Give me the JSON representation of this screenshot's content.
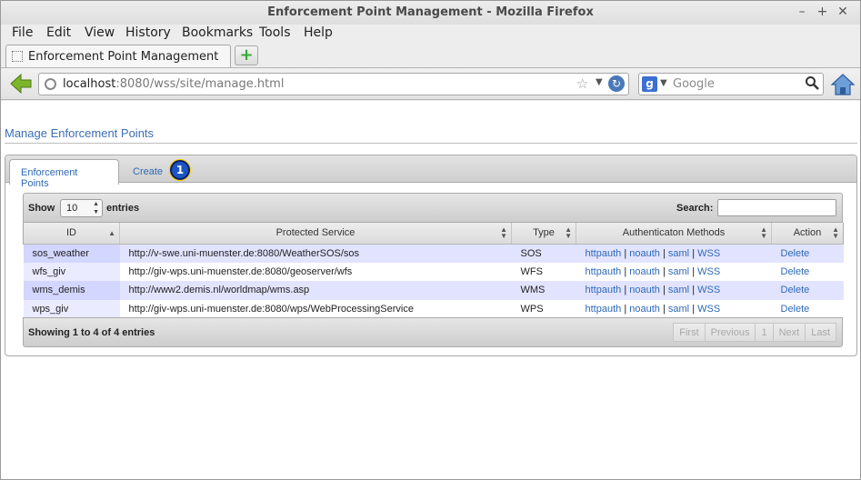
{
  "window": {
    "title": "Enforcement Point Management - Mozilla Firefox",
    "controls": [
      "–",
      "+",
      "✕"
    ]
  },
  "menu": [
    "File",
    "Edit",
    "View",
    "History",
    "Bookmarks",
    "Tools",
    "Help"
  ],
  "browser_tab": {
    "label": "Enforcement Point Management",
    "new_tab": "+"
  },
  "address": {
    "host": "localhost",
    "rest": ":8080/wss/site/manage.html"
  },
  "search": {
    "placeholder": "Google",
    "engine_icon": "g"
  },
  "page": {
    "title": "Manage Enforcement Points",
    "tabs": [
      {
        "label": "Enforcement Points",
        "active": true
      },
      {
        "label": "Create",
        "active": false
      }
    ],
    "badge": "1",
    "table": {
      "show_label": "Show",
      "length_value": "10",
      "entries_label": "entries",
      "search_label": "Search:",
      "search_value": "",
      "columns": [
        "ID",
        "Protected Service",
        "Type",
        "Authenticaton Methods",
        "Action"
      ],
      "rows": [
        {
          "id": "sos_weather",
          "service": "http://v-swe.uni-muenster.de:8080/WeatherSOS/sos",
          "type": "SOS",
          "methods": [
            "httpauth",
            "noauth",
            "saml",
            "WSS"
          ],
          "action": "Delete"
        },
        {
          "id": "wfs_giv",
          "service": "http://giv-wps.uni-muenster.de:8080/geoserver/wfs",
          "type": "WFS",
          "methods": [
            "httpauth",
            "noauth",
            "saml",
            "WSS"
          ],
          "action": "Delete"
        },
        {
          "id": "wms_demis",
          "service": "http://www2.demis.nl/worldmap/wms.asp",
          "type": "WMS",
          "methods": [
            "httpauth",
            "noauth",
            "saml",
            "WSS"
          ],
          "action": "Delete"
        },
        {
          "id": "wps_giv",
          "service": "http://giv-wps.uni-muenster.de:8080/wps/WebProcessingService",
          "type": "WPS",
          "methods": [
            "httpauth",
            "noauth",
            "saml",
            "WSS"
          ],
          "action": "Delete"
        }
      ],
      "method_separator": "|",
      "info": "Showing 1 to 4 of 4 entries",
      "pager": [
        "First",
        "Previous",
        "1",
        "Next",
        "Last"
      ]
    }
  }
}
